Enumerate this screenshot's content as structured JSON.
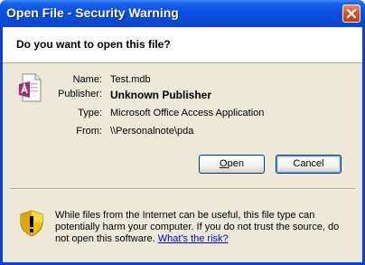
{
  "window": {
    "title": "Open File - Security Warning"
  },
  "header": {
    "question": "Do you want to open this file?"
  },
  "file": {
    "icon": "access-database-file-icon",
    "name_label": "Name:",
    "name_value": "Test.mdb",
    "publisher_label": "Publisher:",
    "publisher_value": "Unknown Publisher",
    "type_label": "Type:",
    "type_value": "Microsoft Office Access Application",
    "from_label": "From:",
    "from_value": "\\\\Personalnote\\pda"
  },
  "buttons": {
    "open_underlined": "O",
    "open_rest": "pen",
    "cancel_label": "Cancel"
  },
  "warning": {
    "icon": "shield-warning-icon",
    "text": "While files from the Internet can be useful, this file type can potentially harm your computer. If you do not trust the source, do not open this software. ",
    "link": "What's the risk?"
  },
  "colors": {
    "titlebar": "#0a4bd8",
    "dialog_bg": "#ece9d8",
    "close_button": "#d5552e"
  }
}
